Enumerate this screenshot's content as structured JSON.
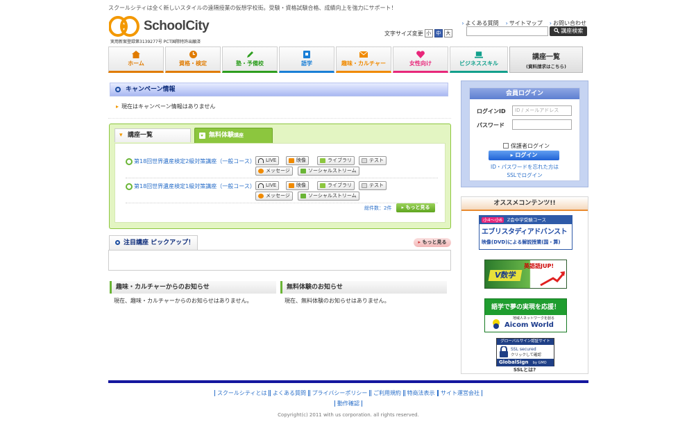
{
  "header": {
    "tagline": "スクールシティは全く新しいスタイルの遠隔授業の仮想学校街。受験・資格試験合格、成績向上を強力にサポート！",
    "logo_text": "SchoolCity",
    "logo_sub": "実用新案登録第3139277号 PCT国際特許出願済",
    "links": [
      "よくある質問",
      "サイトマップ",
      "お問い合わせ"
    ],
    "font_size_label": "文字サイズ変更",
    "font_sizes": [
      "小",
      "中",
      "大"
    ],
    "search_placeholder": "",
    "search_button": "講座検索"
  },
  "nav": {
    "items": [
      {
        "label": "ホーム",
        "icon": "home-icon",
        "color": "#e07b00"
      },
      {
        "label": "資格・検定",
        "icon": "clock-icon",
        "color": "#e07b00"
      },
      {
        "label": "塾・予備校",
        "icon": "pencil-icon",
        "color": "#2e9e1f"
      },
      {
        "label": "語学",
        "icon": "book-icon",
        "color": "#1a7fd6"
      },
      {
        "label": "趣味・カルチャー",
        "icon": "mail-icon",
        "color": "#f08a00"
      },
      {
        "label": "女性向け",
        "icon": "heart-icon",
        "color": "#e8277a"
      },
      {
        "label": "ビジネススキル",
        "icon": "laptop-icon",
        "color": "#12a08c"
      },
      {
        "label": "講座一覧",
        "sub": "(資料請求はこちら)"
      }
    ]
  },
  "campaign": {
    "title": "キャンペーン情報",
    "body": "現在はキャンペーン情報はありません"
  },
  "courses": {
    "tab_list": "講座一覧",
    "tab_trial": "無料体験",
    "tab_trial_small": "講座",
    "rows": [
      {
        "title": "第18回世界遺産検定2級対策講座（一般コース）"
      },
      {
        "title": "第18回世界遺産検定1級対策講座（一般コース）"
      }
    ],
    "chips": [
      "LIVE",
      "映像",
      "ライブラリ",
      "テスト",
      "メッセージ",
      "ソーシャルストリーム"
    ],
    "total": "総件数：2件",
    "more": "もっと見る"
  },
  "pickup": {
    "title": "注目講座 ピックアップ！",
    "more": "もっと見る"
  },
  "news": [
    {
      "title": "趣味・カルチャーからのお知らせ",
      "body": "現在、趣味・カルチャーからのお知らせはありません。"
    },
    {
      "title": "無料体験のお知らせ",
      "body": "現在、無料体験のお知らせはありません。"
    }
  ],
  "login": {
    "title": "会員ログイン",
    "id_label": "ログインID",
    "id_placeholder": "ID / メールアドレス",
    "pw_label": "パスワード",
    "guardian": "保護者ログイン",
    "button": "ログイン",
    "forgot1": "ID・パスワードを忘れた方は",
    "forgot2": "SSLでログイン"
  },
  "recommend": {
    "title": "オススメコンテンツ!!",
    "banner1_top": "小4～小6",
    "banner1_title": "Z会中学受験コース",
    "banner1_main": "エブリスタディアドバンスト",
    "banner1_sub": "映像(DVD)による解説授業(国・算)",
    "banner2_main": "V数学",
    "banner2_tag": "英語語JUP!",
    "banner3_title": "語学で夢の実現を応援！",
    "banner3_sub": "地域人ネットワークを創る",
    "banner3_brand": "Aicom World",
    "banner4_title": "グローバルサイン認証サイト",
    "banner4_ssl": "SSL secured",
    "banner4_click": "クリックして確認",
    "banner4_brand": "GlobalSign",
    "banner4_gmo": "by GMO",
    "ssl_caption": "SSLとは?"
  },
  "footer": {
    "links": [
      "スクールシティとは",
      "よくある質問",
      "プライバシーポリシー",
      "ご利用規約",
      "特商法表示",
      "サイト運営会社"
    ],
    "links2": [
      "動作確認"
    ],
    "copyright": "Copyright(c) 2011 with us corporation. all rights reserved."
  }
}
